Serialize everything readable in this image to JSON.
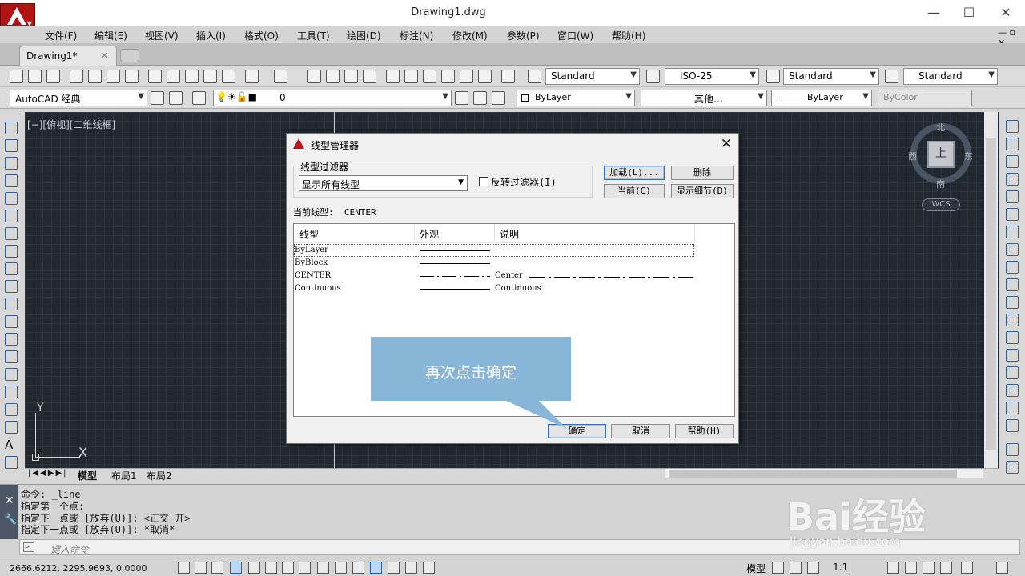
{
  "window": {
    "title": "Drawing1.dwg",
    "min": "—",
    "max": "☐",
    "close": "✕"
  },
  "menu": [
    "文件(F)",
    "编辑(E)",
    "视图(V)",
    "插入(I)",
    "格式(O)",
    "工具(T)",
    "绘图(D)",
    "标注(N)",
    "修改(M)",
    "参数(P)",
    "窗口(W)",
    "帮助(H)"
  ],
  "doc_tab": {
    "label": "Drawing1*",
    "close": "✕"
  },
  "toolbar1": {
    "text_style": "Standard",
    "dim_style": "ISO-25",
    "table_style": "Standard",
    "mleader_style": "Standard"
  },
  "toolbar2": {
    "workspace": "AutoCAD 经典",
    "layer": "0",
    "color": "ByLayer",
    "linetype": "其他...",
    "lineweight": "ByLayer",
    "plotstyle": "ByColor"
  },
  "viewport_label": "[−][俯视][二维线框]",
  "viewcube": {
    "north": "北",
    "south": "南",
    "east": "东",
    "west": "西",
    "face": "上",
    "wcs": "WCS"
  },
  "ucs": {
    "x": "X",
    "y": "Y"
  },
  "layout_tabs": [
    "模型",
    "布局1",
    "布局2"
  ],
  "command_history": [
    "命令: _line",
    "指定第一个点:",
    "指定下一点或 [放弃(U)]:  <正交 开>",
    "指定下一点或 [放弃(U)]: *取消*"
  ],
  "command_prompt": "键入命令",
  "statusbar": {
    "coords": "2666.6212, 2295.9693, 0.0000",
    "model": "模型",
    "scale": "1:1"
  },
  "dialog": {
    "title": "线型管理器",
    "filter_title": "线型过滤器",
    "filter_value": "显示所有线型",
    "invert_label": "反转过滤器(I)",
    "btn_load": "加载(L)...",
    "btn_delete": "删除",
    "btn_current": "当前(C)",
    "btn_details": "显示细节(D)",
    "current_label": "当前线型:",
    "current_value": "CENTER",
    "columns": [
      "线型",
      "外观",
      "说明"
    ],
    "rows": [
      {
        "name": "ByLayer",
        "desc": ""
      },
      {
        "name": "ByBlock",
        "desc": ""
      },
      {
        "name": "CENTER",
        "desc": "Center"
      },
      {
        "name": "Continuous",
        "desc": "Continuous"
      }
    ],
    "btn_ok": "确定",
    "btn_cancel": "取消",
    "btn_help": "帮助(H)"
  },
  "callout": "再次点击确定",
  "watermark": {
    "main": "Bai经验",
    "sub": "jingyan.baidu.com"
  }
}
